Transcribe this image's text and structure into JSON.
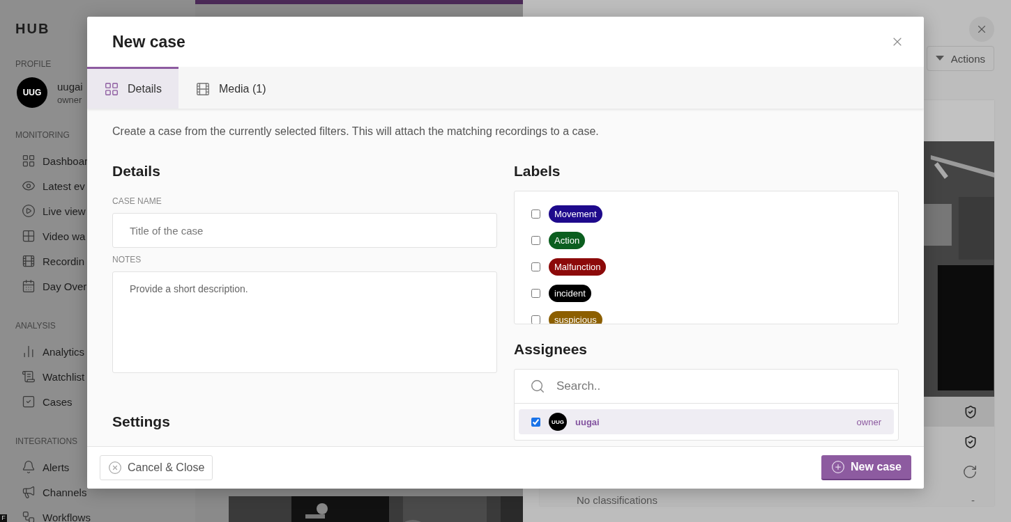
{
  "sidebar": {
    "brand": "HUB",
    "profile_title": "PROFILE",
    "profile": {
      "avatar": "UUG",
      "name": "uugai",
      "role": "owner"
    },
    "sections": [
      {
        "title": "MONITORING",
        "items": [
          {
            "label": "Dashboar",
            "kind": "grid"
          },
          {
            "label": "Latest ev",
            "kind": "eye"
          },
          {
            "label": "Live view",
            "kind": "play"
          },
          {
            "label": "Video wa",
            "kind": "tiles"
          },
          {
            "label": "Recordin",
            "kind": "film"
          },
          {
            "label": "Day Over",
            "kind": "calendar"
          }
        ]
      },
      {
        "title": "ANALYSIS",
        "items": [
          {
            "label": "Analytics",
            "kind": "bars"
          },
          {
            "label": "Watchlist",
            "kind": "list"
          },
          {
            "label": "Cases",
            "kind": "check"
          }
        ]
      },
      {
        "title": "INTEGRATIONS",
        "items": [
          {
            "label": "Alerts",
            "kind": "bell"
          },
          {
            "label": "Channels",
            "kind": "megaphone"
          },
          {
            "label": "Workflows",
            "kind": "workflow"
          }
        ]
      }
    ]
  },
  "corner_badge": "F",
  "panel": {
    "actions_button": "Actions",
    "rows": [
      {
        "kind": "shield",
        "selected": true
      },
      {
        "kind": "shield",
        "selected": false
      },
      {
        "kind": "refresh",
        "selected": false
      }
    ],
    "classification": {
      "label": "No classifications",
      "value": "-"
    }
  },
  "modal": {
    "title": "New case",
    "tabs": [
      {
        "label": "Details",
        "kind": "grid",
        "selected": true
      },
      {
        "label": "Media (1)",
        "kind": "film",
        "selected": false
      }
    ],
    "description": "Create a case from the currently selected filters. This will attach the matching recordings to a case.",
    "details_heading": "Details",
    "case_name_label": "CASE NAME",
    "case_name_placeholder": "Title of the case",
    "notes_label": "NOTES",
    "notes_placeholder": "Provide a short description.",
    "settings_heading": "Settings",
    "labels_heading": "Labels",
    "labels": [
      {
        "name": "Movement",
        "color": "#1e0a8c",
        "checked": false
      },
      {
        "name": "Action",
        "color": "#0b5e1f",
        "checked": false
      },
      {
        "name": "Malfunction",
        "color": "#8c0a0a",
        "checked": false
      },
      {
        "name": "incident",
        "color": "#000000",
        "checked": false
      },
      {
        "name": "suspicious",
        "color": "#8c5f00",
        "checked": false
      }
    ],
    "assignees_heading": "Assignees",
    "search_placeholder": "Search..",
    "assignees": [
      {
        "avatar": "UUG",
        "name": "uugai",
        "role": "owner",
        "checked": true,
        "selected": true
      }
    ],
    "cancel_button": "Cancel & Close",
    "submit_button": "New case"
  }
}
